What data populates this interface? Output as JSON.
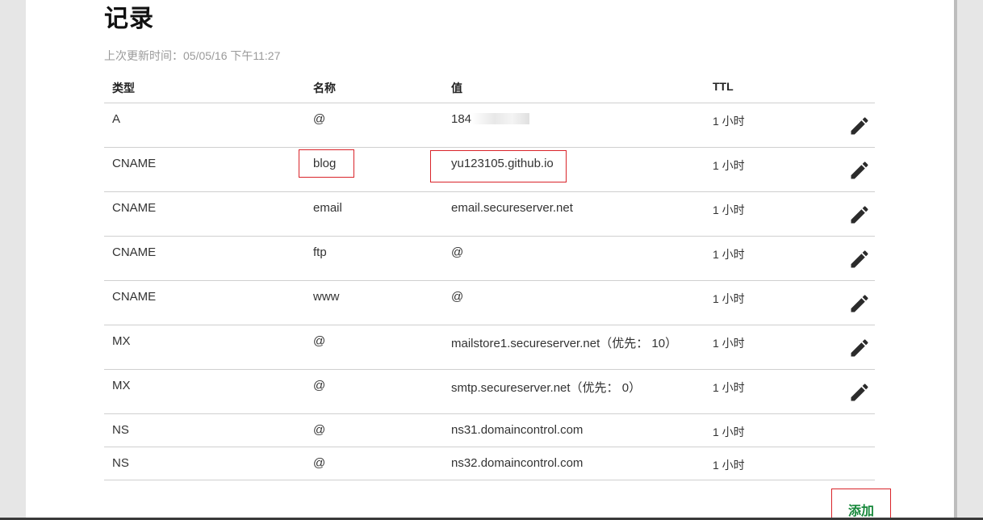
{
  "page": {
    "title": "记录",
    "last_updated": "上次更新时间：05/05/16 下午11:27"
  },
  "table": {
    "headers": {
      "type": "类型",
      "name": "名称",
      "value": "值",
      "ttl": "TTL"
    },
    "rows": [
      {
        "type": "A",
        "name": "@",
        "value": "184",
        "value_masked": true,
        "ttl": "1 小时",
        "editable": true
      },
      {
        "type": "CNAME",
        "name": "blog",
        "value": "yu123105.github.io",
        "ttl": "1 小时",
        "editable": true,
        "highlighted": true
      },
      {
        "type": "CNAME",
        "name": "email",
        "value": "email.secureserver.net",
        "ttl": "1 小时",
        "editable": true
      },
      {
        "type": "CNAME",
        "name": "ftp",
        "value": "@",
        "ttl": "1 小时",
        "editable": true
      },
      {
        "type": "CNAME",
        "name": "www",
        "value": "@",
        "ttl": "1 小时",
        "editable": true
      },
      {
        "type": "MX",
        "name": "@",
        "value": "mailstore1.secureserver.net（优先： 10）",
        "ttl": "1 小时",
        "editable": true
      },
      {
        "type": "MX",
        "name": "@",
        "value": "smtp.secureserver.net（优先： 0）",
        "ttl": "1 小时",
        "editable": true
      },
      {
        "type": "NS",
        "name": "@",
        "value": "ns31.domaincontrol.com",
        "ttl": "1 小时",
        "editable": false
      },
      {
        "type": "NS",
        "name": "@",
        "value": "ns32.domaincontrol.com",
        "ttl": "1 小时",
        "editable": false
      }
    ]
  },
  "actions": {
    "add_label": "添加"
  },
  "icons": {
    "edit": "pencil-icon"
  },
  "colors": {
    "highlight": "#d9242a",
    "add_button": "#17883b",
    "divider": "#cfcfcf"
  }
}
